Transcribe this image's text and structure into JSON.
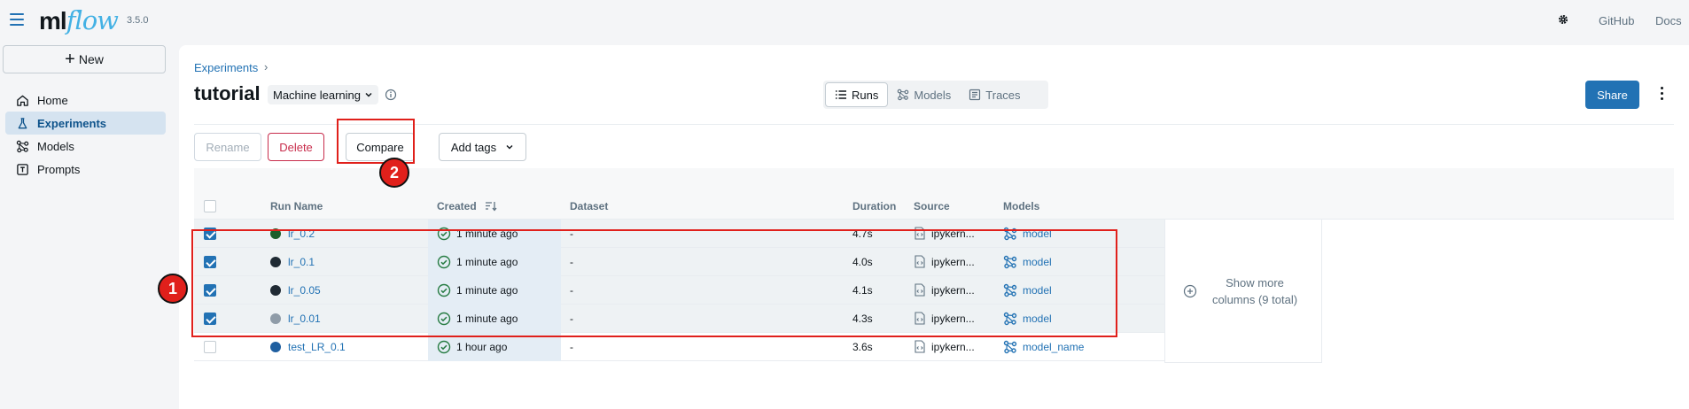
{
  "app": {
    "logo_ml": "ml",
    "logo_flow": "flow",
    "version": "3.5.0"
  },
  "topnav": {
    "github": "GitHub",
    "docs": "Docs"
  },
  "sidebar": {
    "new_label": "New",
    "items": [
      {
        "label": "Home",
        "icon": "home-icon"
      },
      {
        "label": "Experiments",
        "icon": "flask-icon"
      },
      {
        "label": "Models",
        "icon": "models-icon"
      },
      {
        "label": "Prompts",
        "icon": "prompt-icon"
      }
    ]
  },
  "header": {
    "breadcrumb": "Experiments",
    "breadcrumb_sep": "›",
    "title": "tutorial",
    "experiment_type": "Machine learning",
    "tabs": [
      {
        "label": "Runs"
      },
      {
        "label": "Models"
      },
      {
        "label": "Traces"
      }
    ],
    "share_label": "Share"
  },
  "toolbar": {
    "rename": "Rename",
    "delete": "Delete",
    "compare": "Compare",
    "add_tags": "Add tags"
  },
  "annotations": {
    "badge1": "1",
    "badge2": "2"
  },
  "table": {
    "columns": {
      "run_name": "Run Name",
      "created": "Created",
      "dataset": "Dataset",
      "duration": "Duration",
      "source": "Source",
      "models": "Models"
    },
    "rows": [
      {
        "name": "lr_0.2",
        "color": "#1d5e2b",
        "created": "1 minute ago",
        "dataset": "-",
        "duration": "4.7s",
        "source": "ipykern...",
        "model": "model",
        "selected": true
      },
      {
        "name": "lr_0.1",
        "color": "#1f2a33",
        "created": "1 minute ago",
        "dataset": "-",
        "duration": "4.0s",
        "source": "ipykern...",
        "model": "model",
        "selected": true
      },
      {
        "name": "lr_0.05",
        "color": "#1f2a33",
        "created": "1 minute ago",
        "dataset": "-",
        "duration": "4.1s",
        "source": "ipykern...",
        "model": "model",
        "selected": true
      },
      {
        "name": "lr_0.01",
        "color": "#8f9ca8",
        "created": "1 minute ago",
        "dataset": "-",
        "duration": "4.3s",
        "source": "ipykern...",
        "model": "model",
        "selected": true
      },
      {
        "name": "test_LR_0.1",
        "color": "#1f5fa0",
        "created": "1 hour ago",
        "dataset": "-",
        "duration": "3.6s",
        "source": "ipykern...",
        "model": "model_name",
        "selected": false
      }
    ],
    "show_more": "Show more columns (9 total)"
  },
  "colors": {
    "accent": "#2272b4",
    "danger": "#c82d4c",
    "highlight": "#e0201b"
  }
}
